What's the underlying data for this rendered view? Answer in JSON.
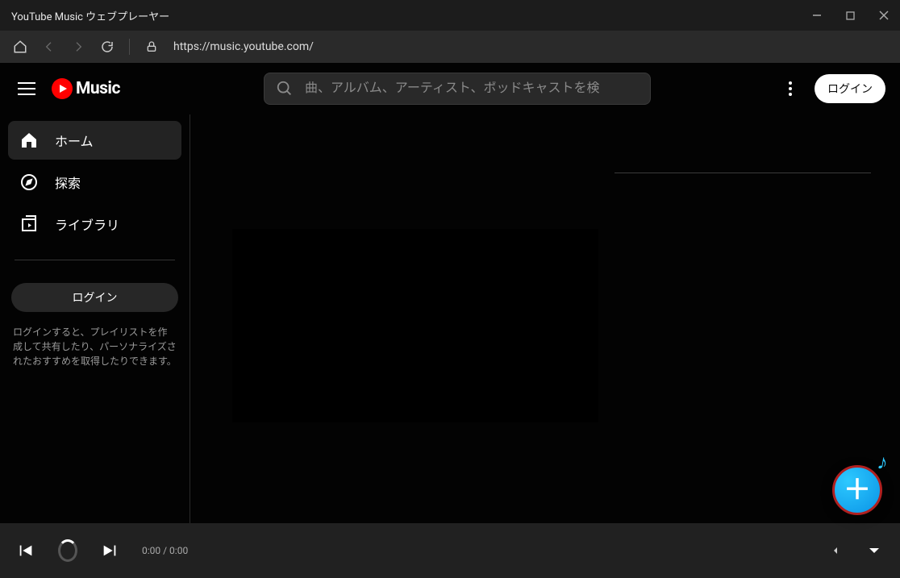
{
  "window": {
    "title": "YouTube Music ウェブプレーヤー"
  },
  "browser": {
    "url": "https://music.youtube.com/"
  },
  "brand": {
    "name": "Music"
  },
  "search": {
    "placeholder": "曲、アルバム、アーティスト、ポッドキャストを検"
  },
  "header": {
    "login": "ログイン"
  },
  "sidebar": {
    "items": [
      {
        "label": "ホーム"
      },
      {
        "label": "探索"
      },
      {
        "label": "ライブラリ"
      }
    ],
    "login_label": "ログイン",
    "login_desc": "ログインすると、プレイリストを作成して共有したり、パーソナライズされたおすすめを取得したりできます。"
  },
  "player": {
    "time_current": "0:00",
    "time_sep": " / ",
    "time_total": "0:00"
  }
}
